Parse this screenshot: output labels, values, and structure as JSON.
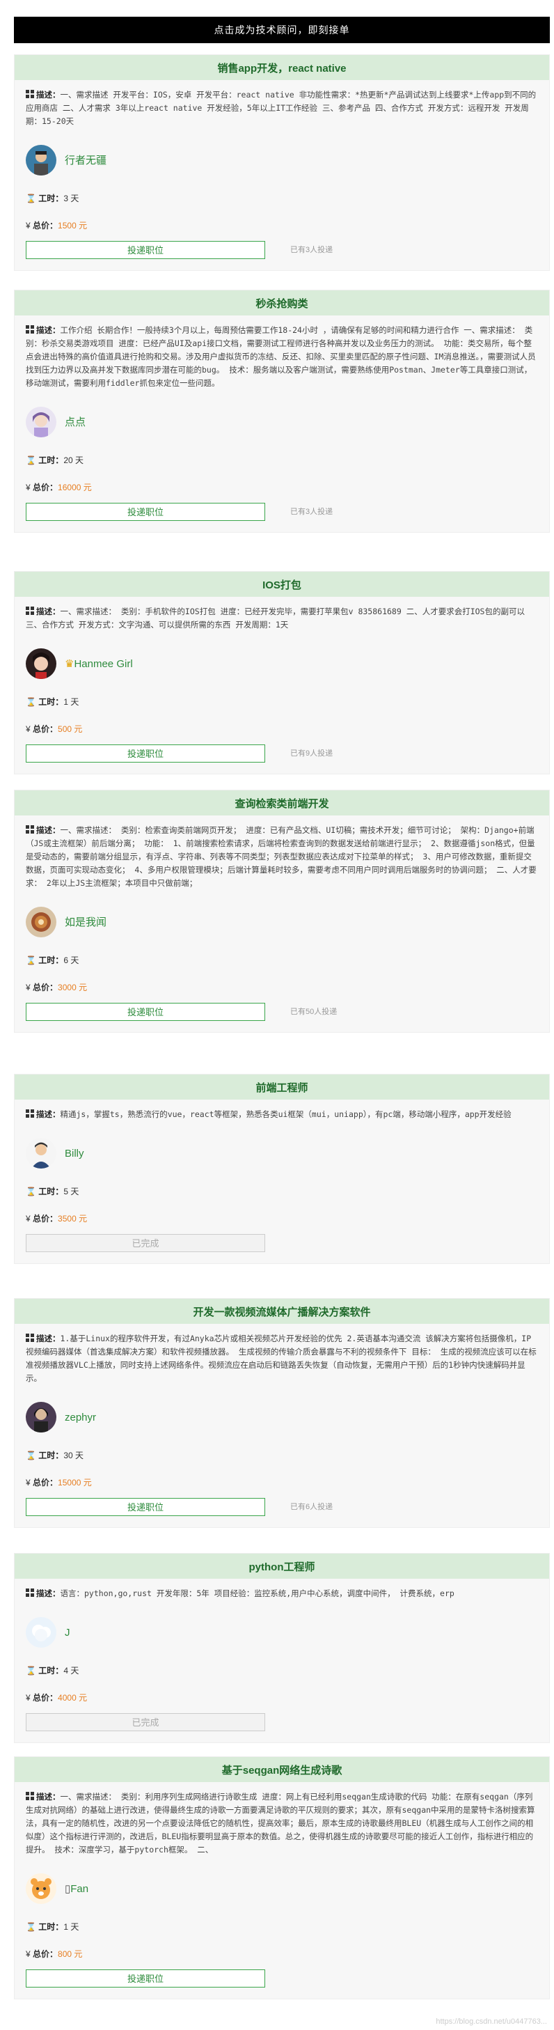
{
  "banner": "点击成为技术顾问，即刻接单",
  "labels": {
    "desc": "描述：",
    "hours": "工时：",
    "price": "总价：",
    "apply_button": "投递职位",
    "done_button": "已完成"
  },
  "cards": [
    {
      "title": "销售app开发，react native",
      "desc": "一、需求描述 开发平台：IOS，安卓 开发平台：react native 非功能性需求：*热更新*产品调试达到上线要求*上传app到不同的应用商店 二、人才需求 3年以上react native 开发经验，5年以上IT工作经验 三、参考产品 四、合作方式 开发方式：远程开发 开发周期：15-20天",
      "user": "行者无疆",
      "hours": "3 天",
      "price": "1500 元",
      "button": "投递职位",
      "applied": "已有3人投递"
    },
    {
      "title": "秒杀抢购类",
      "desc": "工作介绍 长期合作！一般持续3个月以上，每周预估需要工作18-24小时 ，请确保有足够的时间和精力进行合作 一、需求描述： 类别：秒杀交易类游戏项目 进度：已经产品UI及api接口文档，需要测试工程师进行各种高并发以及业务压力的测试。 功能：类交易所，每个整点会进出特殊的高价值道具进行抢购和交易。涉及用户虚拟货币的冻结、反还、扣除、买里卖里匹配的原子性问题、IM消息推送。，需要测试人员找到压力边界以及高并发下数据库同步潜在可能的bug。 技术：服务端以及客户端测试，需要熟练使用Postman、Jmeter等工具章接口测试，移动端测试，需要利用fiddler抓包来定位一些问题。",
      "user": "点点",
      "hours": "20 天",
      "price": "16000 元",
      "button": "投递职位",
      "applied": "已有3人投递"
    },
    {
      "title": "IOS打包",
      "desc": "一、需求描述： 类别：手机软件的IOS打包 进度：已经开发完毕，需要打苹果包v 835861689 二、人才要求会打IOS包的副可以 三、合作方式 开发方式：文字沟通、可以提供所需的东西 开发周期：1天",
      "user": "Hanmee Girl",
      "hours": "1 天",
      "price": "500 元",
      "button": "投递职位",
      "applied": "已有9人投递"
    },
    {
      "title": "查询检索类前端开发",
      "desc": "一、需求描述： 类别：检索查询类前端网页开发； 进度：已有产品文档、UI切稿；需技术开发；细节可讨论； 架构：Django+前端（JS或主流框架）前后端分离； 功能： 1、前端搜索检索请求，后端将检索查询到的数据发送给前端进行显示； 2、数据遵循json格式，但量是受动态的，需要前端分组显示，有浮点、字符串、列表等不同类型；列表型数据应表达成对下拉菜单的样式； 3、用户可修改数据，重新提交数据，页面可实现动态变化； 4、多用户权限管理模块；后端计算量耗时较多，需要考虑不同用户同时调用后端服务时的协调问题； 二、人才要求： 2年以上JS主流框架；本项目中只做前端；",
      "user": "如是我闻",
      "hours": "6 天",
      "price": "3000 元",
      "button": "投递职位",
      "applied": "已有50人投递"
    },
    {
      "title": "前端工程师",
      "desc": "精通js，掌握ts，熟悉流行的vue，react等框架，熟悉各类ui框架（mui，uniapp），有pc端，移动端小程序，app开发经验",
      "user": "Billy",
      "hours": "5 天",
      "price": "3500 元",
      "button": "已完成",
      "applied": ""
    },
    {
      "title": "开发一款视频流媒体广播解决方案软件",
      "desc": "1.基于Linux的程序软件开发，有过Anyka芯片或相关视频芯片开发经验的优先 2.英语基本沟通交流 该解决方案将包括摄像机，IP视频编码器媒体（首选集成解决方案）和软件视频播放器。 生成视频的传输介质会暴露与不利的视频条件下 目标： 生成的视频流应该可以在标准视频播放器VLC上播放，同时支持上述网络条件。视频流应在启动后和链路丢失恢复（自动恢复，无需用户干预）后的1秒钟内快速解码并显示。",
      "user": "zephyr",
      "hours": "30 天",
      "price": "15000 元",
      "button": "投递职位",
      "applied": "已有6人投递"
    },
    {
      "title": "python工程师",
      "desc": "语言：python,go,rust 开发年限：5年 项目经验：监控系统,用户中心系统，调度中间件， 计费系统，erp",
      "user": "J",
      "hours": "4 天",
      "price": "4000 元",
      "button": "已完成",
      "applied": ""
    },
    {
      "title": "基于seqgan网络生成诗歌",
      "desc": "一、需求描述： 类别：利用序列生成网络进行诗歌生成 进度：网上有已经利用seqgan生成诗歌的代码 功能：在原有seqgan（序列生成对抗网络）的基础上进行改进，使得最终生成的诗歌一方面要满足诗歌的平仄规则的要求；其次，原有seqgan中采用的是蒙特卡洛树搜索算法，具有一定的随机性，改进的另一个点要设法降低它的随机性，提高效率；最后，原本生成的诗歌最终用BLEU（机器生成与人工创作之间的相似度）这个指标进行评测的，改进后，BLEU指标要明显高于原本的数值。总之，使得机器生成的诗歌要尽可能的接近人工创作，指标进行相应的提升。 技术：深度学习，基于pytorch框架。 二、",
      "user": "Fan",
      "hours": "1 天",
      "price": "800 元",
      "button": "投递职位",
      "applied": ""
    }
  ],
  "watermark": "https://blog.csdn.net/u0447763..."
}
